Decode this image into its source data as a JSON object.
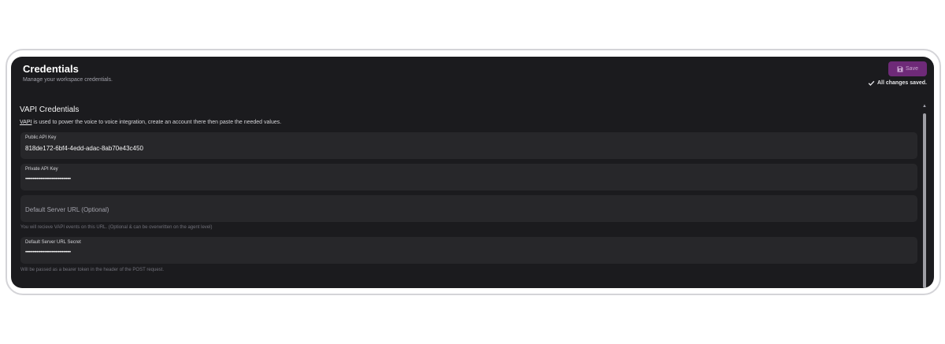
{
  "header": {
    "title": "Credentials",
    "subtitle": "Manage your workspace credentials.",
    "save_label": "Save",
    "saved_status": "All changes saved."
  },
  "section": {
    "title": "VAPI Credentials",
    "link_text": "VAPI",
    "description": " is used to power the voice to voice integration, create an account there then paste the needed values."
  },
  "fields": {
    "public_key": {
      "label": "Public API Key",
      "value": "818de172-6bf4-4edd-adac-8ab70e43c450"
    },
    "private_key": {
      "label": "Private API Key",
      "value": "••••••••••••••••••••••••••••••••••••"
    },
    "server_url": {
      "placeholder": "Default Server URL (Optional)",
      "hint": "You will recieve VAPI events on this URL. (Optional & can be overwritten on the agent level)"
    },
    "server_secret": {
      "label": "Default Server URL Secret",
      "value": "••••••••••••••••••••••••••••••••••••",
      "hint": "Will be passed as a bearer token in the header of the POST request."
    }
  },
  "colors": {
    "panel_bg": "#1b1b1e",
    "field_bg": "#27272a",
    "accent": "#6e2a78"
  }
}
